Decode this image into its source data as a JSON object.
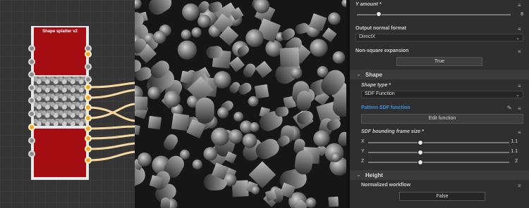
{
  "node": {
    "title": "Shape splatter v2",
    "inputs": 10,
    "outputs": 8
  },
  "panel": {
    "y_amount": {
      "label": "Y amount *",
      "value": "8",
      "fraction": 0.14
    },
    "output_normal_format": {
      "label": "Output normal format",
      "value": "DirectX"
    },
    "non_square_expansion": {
      "label": "Non-square expansion",
      "value": "True"
    },
    "shape_section": {
      "label": "Shape"
    },
    "shape_type": {
      "label": "Shape type *",
      "value": "SDF Function"
    },
    "pattern_sdf": {
      "label": "Pattern SDF function",
      "button": "Edit function"
    },
    "sdf_frame": {
      "label": "SDF bounding frame size *",
      "x": {
        "label": "X",
        "value": "1.1",
        "fraction": 0.37
      },
      "y": {
        "label": "Y",
        "value": "1.1",
        "fraction": 0.37
      },
      "z": {
        "label": "Z",
        "value": "2",
        "fraction": 0.37
      }
    },
    "height_section": {
      "label": "Height"
    },
    "normalized_workflow": {
      "label": "Normalized workflow",
      "value": "False"
    }
  },
  "colors": {
    "node_red": "#a40d12",
    "port_orange": "#f1a62a",
    "link_blue": "#3b8fe0"
  }
}
